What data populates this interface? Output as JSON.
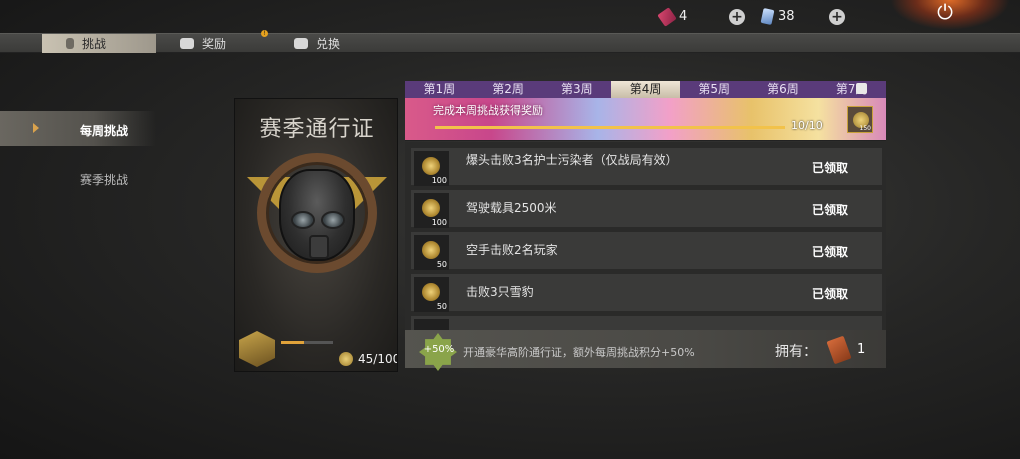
{
  "top": {
    "tickets": "4",
    "cards": "38"
  },
  "tabs": [
    {
      "label": "挑战",
      "active": true
    },
    {
      "label": "奖励",
      "badge": "!"
    },
    {
      "label": "兑换"
    }
  ],
  "sidebar": {
    "items": [
      {
        "label": "每周挑战",
        "active": true
      },
      {
        "label": "赛季挑战"
      }
    ]
  },
  "pass": {
    "title": "赛季通行证",
    "points": "45/100",
    "progress": 0.45
  },
  "weeks": [
    "第1周",
    "第2周",
    "第3周",
    "第4周",
    "第5周",
    "第6周",
    "第7周"
  ],
  "active_week": 3,
  "banner": {
    "title": "完成本周挑战获得奖励",
    "progress": "10/10",
    "fill": 1.0,
    "reward": "150"
  },
  "tasks": [
    {
      "desc": "爆头击败3名护士污染者（仅战局有效）",
      "reward": "100",
      "status": "已领取"
    },
    {
      "desc": "驾驶载具2500米",
      "reward": "100",
      "status": "已领取"
    },
    {
      "desc": "空手击败2名玩家",
      "reward": "50",
      "status": "已领取"
    },
    {
      "desc": "击败3只雪豹",
      "reward": "50",
      "status": "已领取"
    }
  ],
  "bottom": {
    "bonus": "+50%",
    "desc": "开通豪华高阶通行证，额外每周挑战积分+50%",
    "own_label": "拥有：",
    "own_count": "1"
  },
  "colors": {
    "week_bar": "#5a3b7a",
    "accent_gold": "#e0a23a",
    "bonus_green": "#8aa44a"
  },
  "icons": [
    "ticket-icon",
    "card-icon",
    "plus-icon",
    "power-icon",
    "coin-icon",
    "lock-icon",
    "pass-emblem-icon",
    "bonus-badge-icon"
  ]
}
